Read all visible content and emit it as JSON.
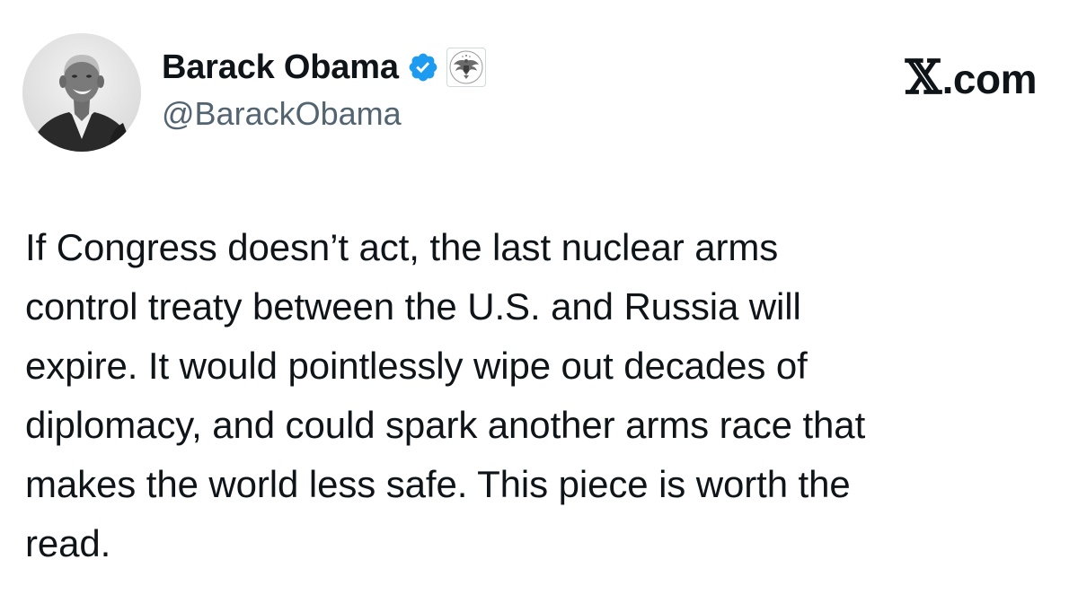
{
  "author": {
    "display_name": "Barack Obama",
    "handle": "@BarackObama",
    "verified": true,
    "affiliation": "official-seal-badge"
  },
  "brand": {
    "x_glyph": "𝕏",
    "domain": ".com"
  },
  "tweet": {
    "lines": [
      "If Congress doesn’t act, the last nuclear arms",
      "control treaty between the U.S. and Russia will",
      "expire. It would pointlessly wipe out decades of",
      "diplomacy, and could spark another arms race that",
      "makes the world less safe. This piece is worth the",
      "read."
    ]
  },
  "icons": {
    "verified": "verified-check-icon",
    "affiliation": "government-seal-icon",
    "avatar": "profile-photo"
  },
  "colors": {
    "verified_blue": "#1d9bf0",
    "text_primary": "#0f1419",
    "text_secondary": "#536471"
  }
}
